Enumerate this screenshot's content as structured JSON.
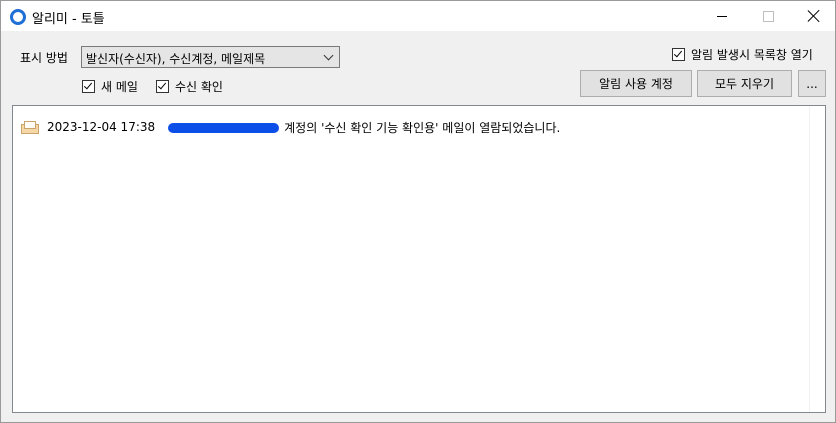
{
  "window": {
    "title": "알리미 - 토틀",
    "app_icon": "ring-icon",
    "controls": [
      "minimize-icon",
      "maximize-icon",
      "close-icon"
    ]
  },
  "options": {
    "display_label": "표시 방법",
    "display_value": "발신자(수신자), 수신계정, 메일제목",
    "new_mail_label": "새 메일",
    "new_mail_checked": true,
    "read_receipt_label": "수신 확인",
    "read_receipt_checked": true,
    "open_list_label": "알림 발생시 목록창 열기",
    "open_list_checked": true
  },
  "buttons": {
    "accounts": "알림 사용 계정",
    "clear_all": "모두 지우기",
    "more": "..."
  },
  "notifications": [
    {
      "icon": "open-envelope-icon",
      "timestamp": "2023-12-04 17:38",
      "message": "계정의 '수신 확인 기능 확인용' 메일이 열람되었습니다."
    }
  ],
  "colors": {
    "accent": "#1e6fd6",
    "redaction": "#0b4ee8"
  }
}
